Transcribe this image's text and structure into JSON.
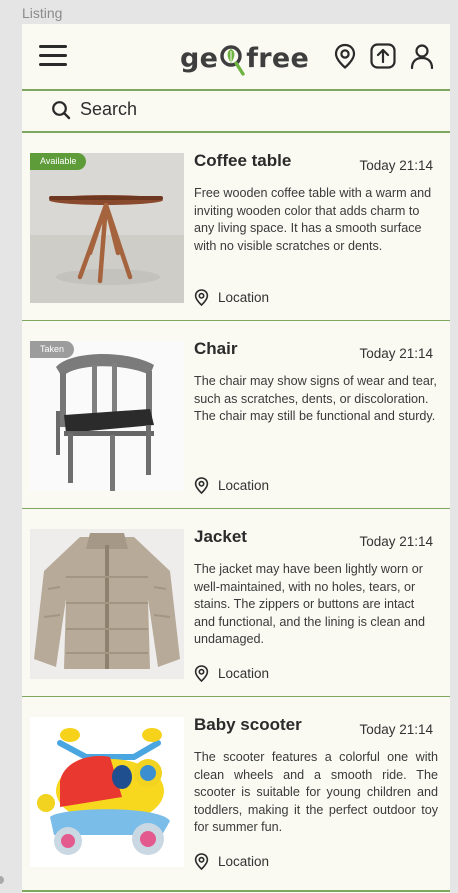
{
  "canvas": {
    "label": "Listing"
  },
  "header": {
    "logo_left": "ge",
    "logo_right": "free",
    "logo_icon": "map-pin-leaf-logo",
    "icons": [
      "menu-icon",
      "location-pin-icon",
      "upload-icon",
      "user-icon"
    ]
  },
  "search": {
    "placeholder": "Search",
    "icon": "search-icon"
  },
  "colors": {
    "accent": "#7ea85f",
    "available_badge": "#5e9c3a",
    "taken_badge": "#9c9c9c",
    "background": "#fafaf3"
  },
  "listings": [
    {
      "title": "Coffee table",
      "time": "Today 21:14",
      "status": "Available",
      "description": "Free wooden coffee table with a warm and inviting wooden color that adds charm to any living space. It has a smooth surface with no visible scratches or dents.",
      "location": "Location",
      "image": "coffee-table-image"
    },
    {
      "title": "Chair",
      "time": "Today 21:14",
      "status": "Taken",
      "description": "The chair may show signs of wear and tear, such as scratches, dents, or discoloration. The chair may still be functional and sturdy.",
      "location": "Location",
      "image": "chair-image"
    },
    {
      "title": "Jacket",
      "time": "Today 21:14",
      "description": "The jacket may have been lightly worn or well-maintained, with no holes, tears, or stains. The zippers or buttons are intact and functional, and the lining is clean and undamaged.",
      "location": "Location",
      "image": "jacket-image"
    },
    {
      "title": "Baby scooter",
      "time": "Today 21:14",
      "description": "The scooter features a colorful one with clean wheels and a smooth ride. The scooter is suitable for young children and toddlers, making it the perfect outdoor toy for summer fun.",
      "location": "Location",
      "image": "baby-scooter-image"
    }
  ]
}
